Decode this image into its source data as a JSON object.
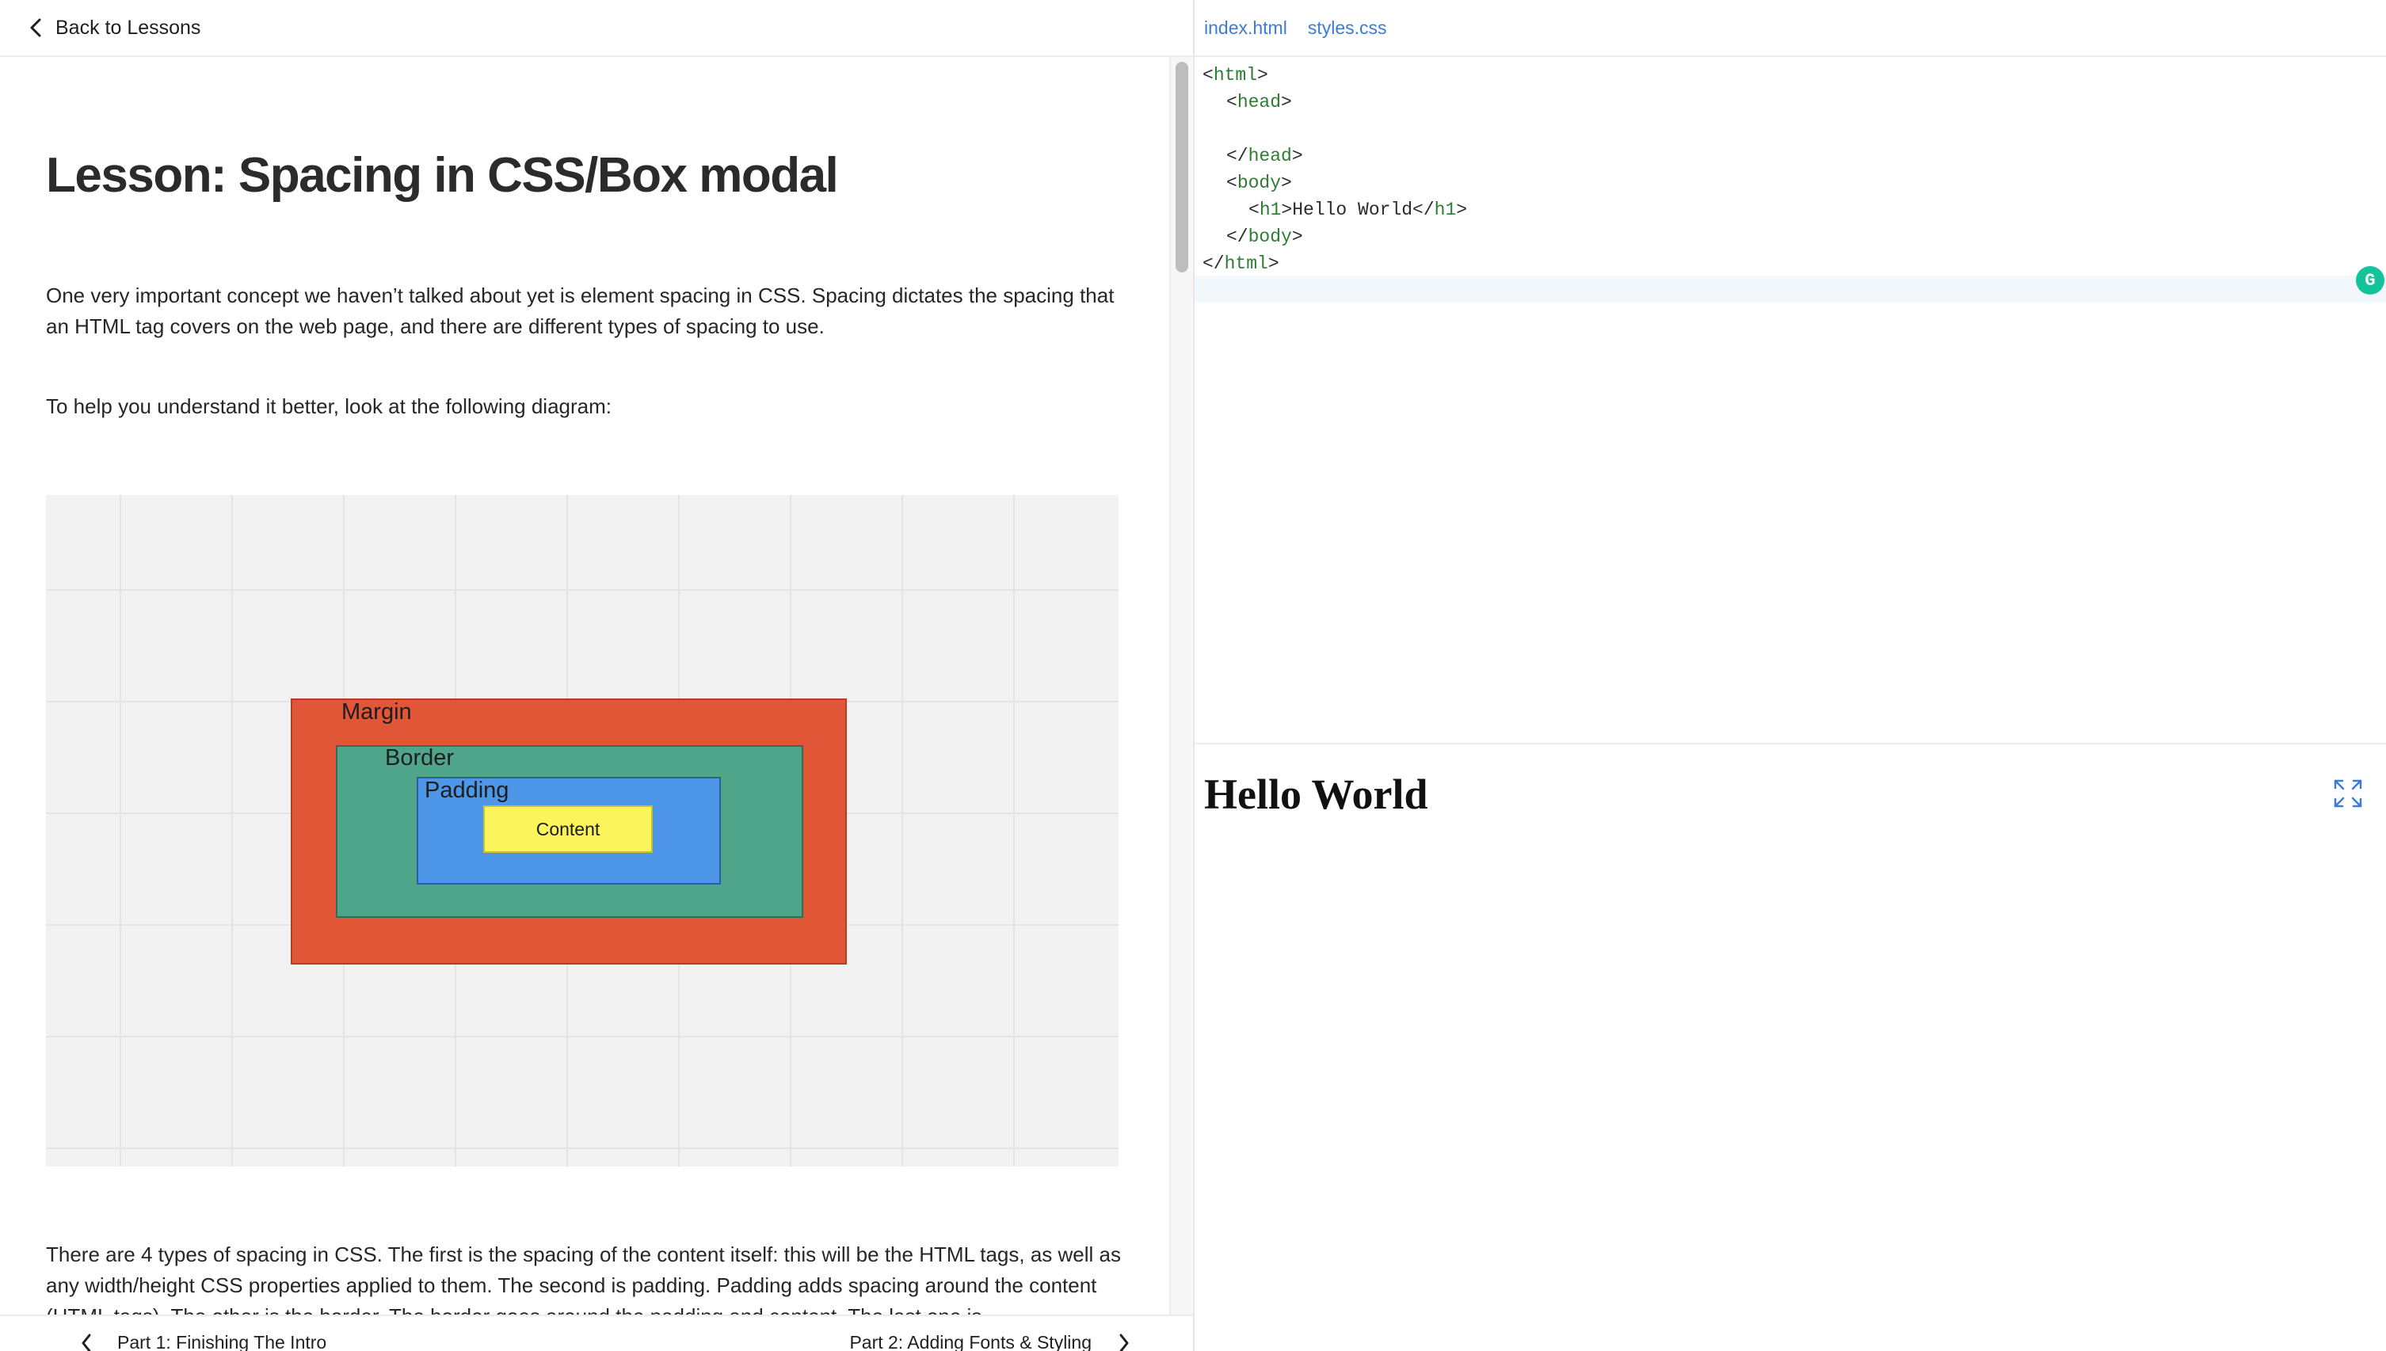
{
  "header": {
    "back_label": "Back to Lessons"
  },
  "lesson": {
    "title": "Lesson: Spacing in CSS/Box modal",
    "paragraph1": "One very important concept we haven’t talked about yet is element spacing in CSS. Spacing dictates the spacing that an HTML tag covers on the web page, and there are different types of spacing to use.",
    "paragraph2": "To help you understand it better, look at the following diagram:",
    "paragraph3": "There are 4 types of spacing in CSS. The first is the spacing of the content itself: this will be the HTML tags, as well as any width/height CSS properties applied to them. The second is padding. Padding adds spacing around the content (HTML tags). The other is the border. The border goes around the padding and content. The last one is"
  },
  "diagram": {
    "margin_label": "Margin",
    "border_label": "Border",
    "padding_label": "Padding",
    "content_label": "Content"
  },
  "nav": {
    "prev_label": "Part 1: Finishing The Intro",
    "next_label": "Part 2: Adding Fonts & Styling"
  },
  "editor": {
    "tabs": [
      "index.html",
      "styles.css"
    ],
    "lines": {
      "l1_open": "<",
      "l1_tag": "html",
      "l1_close": ">",
      "l2_open": "<",
      "l2_tag": "head",
      "l2_close": ">",
      "l4_open": "</",
      "l4_tag": "head",
      "l4_close": ">",
      "l5_open": "<",
      "l5_tag": "body",
      "l5_close": ">",
      "l6_open": "<",
      "l6_tag": "h1",
      "l6_mid": ">Hello World</",
      "l6_tag2": "h1",
      "l6_close": ">",
      "l7_open": "</",
      "l7_tag": "body",
      "l7_close": ">",
      "l8_open": "</",
      "l8_tag": "html",
      "l8_close": ">"
    }
  },
  "preview": {
    "heading": "Hello World"
  },
  "icons": {
    "back": "chevron-left-icon",
    "prev": "chevron-left-icon",
    "next": "chevron-right-icon",
    "grammarly": "grammarly-icon",
    "expand": "expand-icon"
  },
  "colors": {
    "margin": "#e05637",
    "border": "#4fa58a",
    "padding": "#4e96e8",
    "content": "#fbf45b",
    "link": "#3d7bd6",
    "code_tag": "#2e7d32"
  }
}
